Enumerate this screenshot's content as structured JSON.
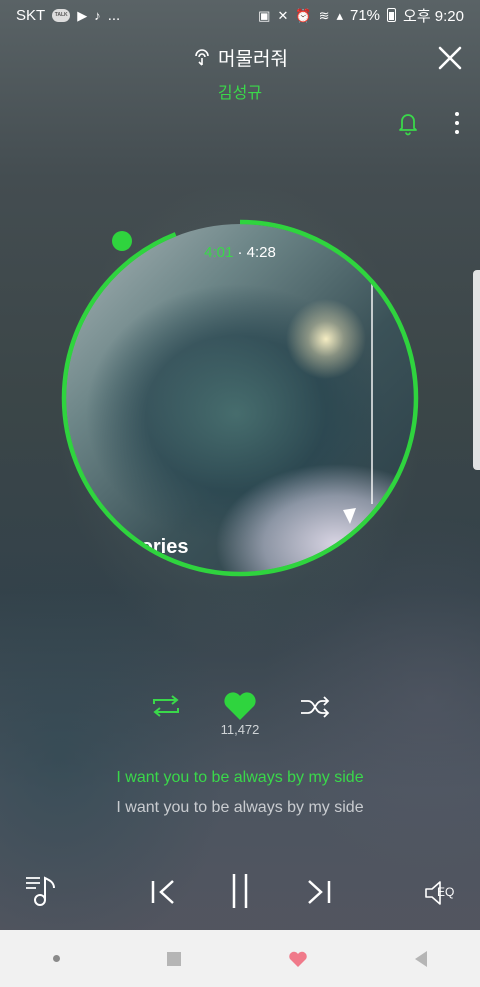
{
  "status_bar": {
    "carrier": "SKT",
    "talk_badge": "TALK",
    "more": "...",
    "battery": "71%",
    "time": "오후 9:20"
  },
  "player": {
    "song_title": "머물러줘",
    "artist": "김성규",
    "current_time": "4:01",
    "separator": "·",
    "total_time": "4:28",
    "progress": 0.94,
    "album_caption": "tories",
    "likes": "11,472"
  },
  "lyrics": {
    "current": "I want you to be always by my side",
    "next": "I want you to be always by my side"
  },
  "controls": {
    "eq_label": "EQ"
  },
  "colors": {
    "accent": "#3ad84a",
    "ring": "#2fd43e",
    "text_dim": "#c9ccd0"
  },
  "icons": {
    "repeat": "repeat-icon",
    "heart": "heart-icon",
    "shuffle": "shuffle-icon",
    "bell": "bell-icon",
    "close": "close-icon",
    "more": "more-vertical-icon",
    "playlist": "playlist-music-icon",
    "prev": "skip-previous-icon",
    "pause": "pause-icon",
    "next": "skip-next-icon",
    "eq": "equalizer-speaker-icon"
  }
}
